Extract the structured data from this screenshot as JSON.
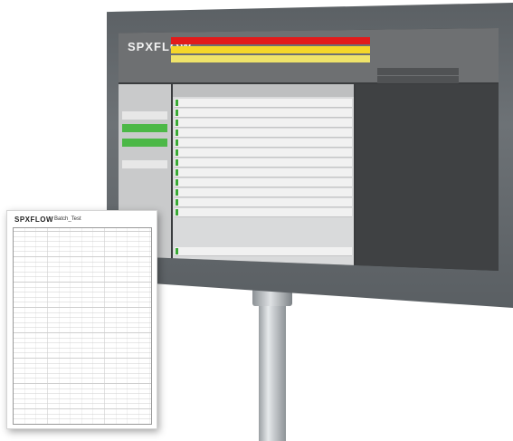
{
  "monitor": {
    "logo": "SPXFLOW",
    "alarms": [
      "",
      "",
      ""
    ],
    "info": [
      "",
      "",
      ""
    ],
    "sidebar": [
      "",
      "",
      "",
      ""
    ],
    "table_header": "",
    "table_rows": [
      "",
      "",
      "",
      "",
      "",
      "",
      "",
      "",
      "",
      "",
      "",
      "",
      ""
    ],
    "brand_colors": {
      "alarm_red": "#e21b1b",
      "alarm_yellow": "#f5d629",
      "status_green": "#4cb847"
    }
  },
  "document": {
    "logo": "SPXFLOW",
    "title": "Batch_Test",
    "date": "",
    "sections": [
      "",
      "",
      "",
      "",
      ""
    ]
  }
}
